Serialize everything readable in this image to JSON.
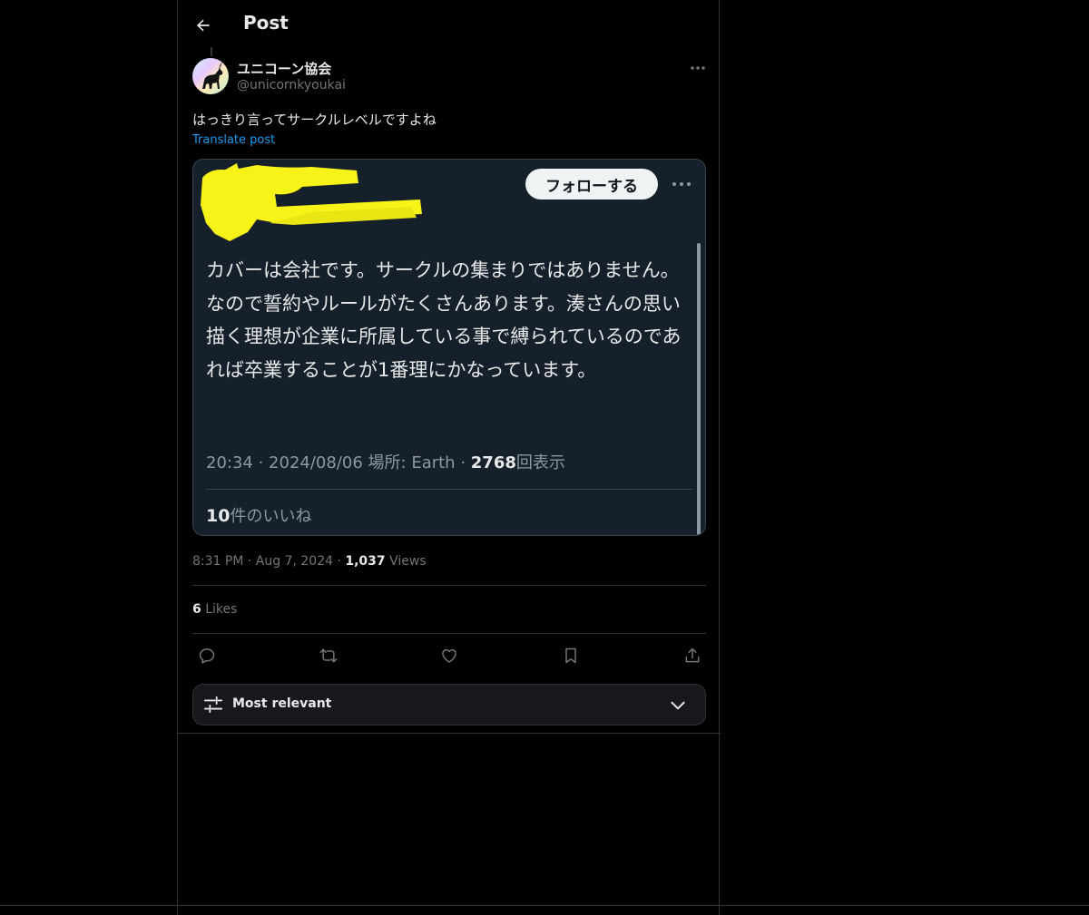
{
  "header": {
    "title": "Post"
  },
  "author": {
    "display_name": "ユニコーン協会",
    "handle": "@unicornkyoukai"
  },
  "post": {
    "text": "はっきり言ってサークルレベルですよね",
    "translate_label": "Translate post"
  },
  "embedded": {
    "follow_label": "フォローする",
    "body": "カバーは会社です。サークルの集まりではありません。なので誓約やルールがたくさんあります。湊さんの思い描く理想が企業に所属している事で縛られているのであれば卒業することが1番理にかなっています。",
    "time": "20:34",
    "date": "2024/08/06",
    "location": "場所: Earth",
    "views_count": "2768",
    "views_label": "回表示",
    "likes_count": "10",
    "likes_label": "件のいいね"
  },
  "meta": {
    "time": "8:31 PM",
    "date": "Aug 7, 2024",
    "views_count": "1,037",
    "views_label": "Views",
    "separator": "·"
  },
  "likes": {
    "count": "6",
    "label": "Likes"
  },
  "actions": [
    "reply-icon",
    "repost-icon",
    "like-icon",
    "bookmark-icon",
    "share-icon"
  ],
  "sort": {
    "label": "Most relevant"
  },
  "colors": {
    "background": "#000000",
    "accent": "#1d9bf0",
    "embed_background": "#15202b",
    "text_primary": "#e7e9ea",
    "text_secondary": "#71767b"
  }
}
